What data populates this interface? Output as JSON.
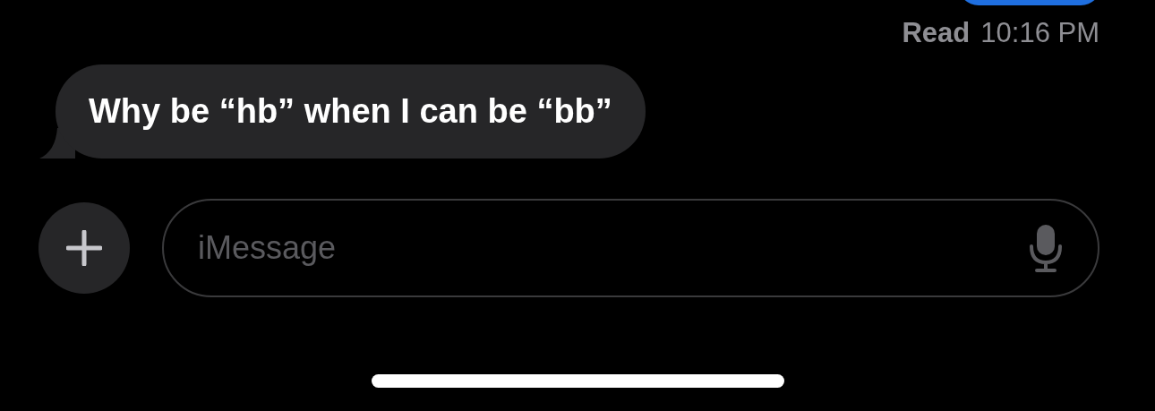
{
  "receipt": {
    "status": "Read",
    "time": "10:16 PM"
  },
  "messages": [
    {
      "kind": "received",
      "text": "Why be “hb” when I can be “bb”"
    }
  ],
  "composer": {
    "placeholder": "iMessage"
  }
}
